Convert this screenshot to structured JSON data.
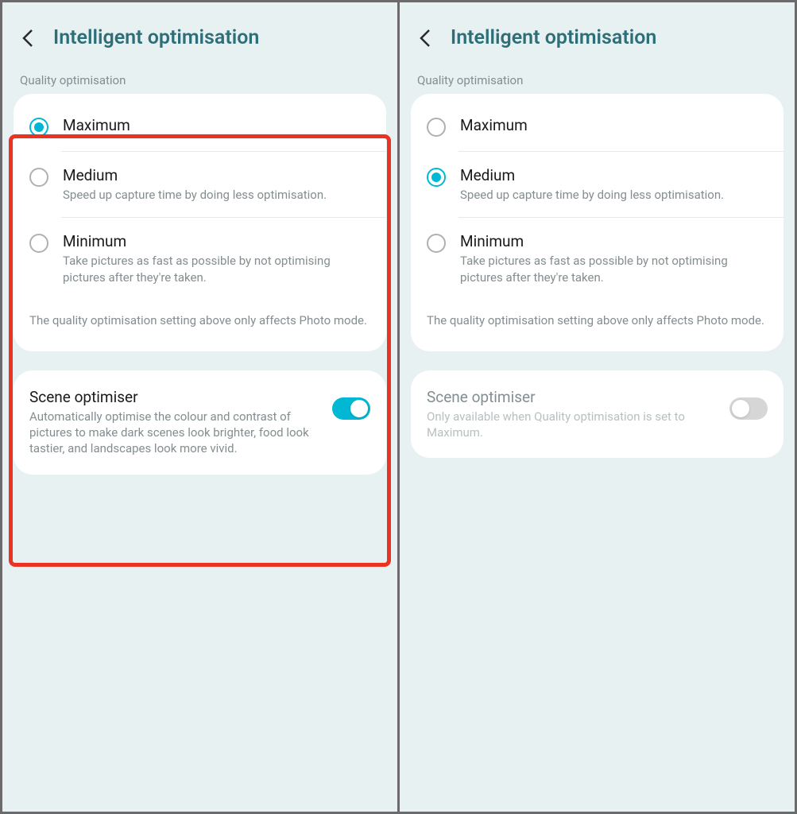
{
  "left": {
    "title": "Intelligent optimisation",
    "section_label": "Quality optimisation",
    "options": [
      {
        "label": "Maximum",
        "desc": "",
        "selected": true
      },
      {
        "label": "Medium",
        "desc": "Speed up capture time by doing less optimisation.",
        "selected": false
      },
      {
        "label": "Minimum",
        "desc": "Take pictures as fast as possible by not optimising pictures after they're taken.",
        "selected": false
      }
    ],
    "footnote": "The quality optimisation setting above only affects Photo mode.",
    "scene": {
      "title": "Scene optimiser",
      "desc": "Automatically optimise the colour and contrast of pictures to make dark scenes look brighter, food look tastier, and landscapes look more vivid.",
      "enabled": true,
      "on": true
    }
  },
  "right": {
    "title": "Intelligent optimisation",
    "section_label": "Quality optimisation",
    "options": [
      {
        "label": "Maximum",
        "desc": "",
        "selected": false
      },
      {
        "label": "Medium",
        "desc": "Speed up capture time by doing less optimisation.",
        "selected": true
      },
      {
        "label": "Minimum",
        "desc": "Take pictures as fast as possible by not optimising pictures after they're taken.",
        "selected": false
      }
    ],
    "footnote": "The quality optimisation setting above only affects Photo mode.",
    "scene": {
      "title": "Scene optimiser",
      "desc": "Only available when Quality optimisation is set to Maximum.",
      "enabled": false,
      "on": false
    }
  }
}
